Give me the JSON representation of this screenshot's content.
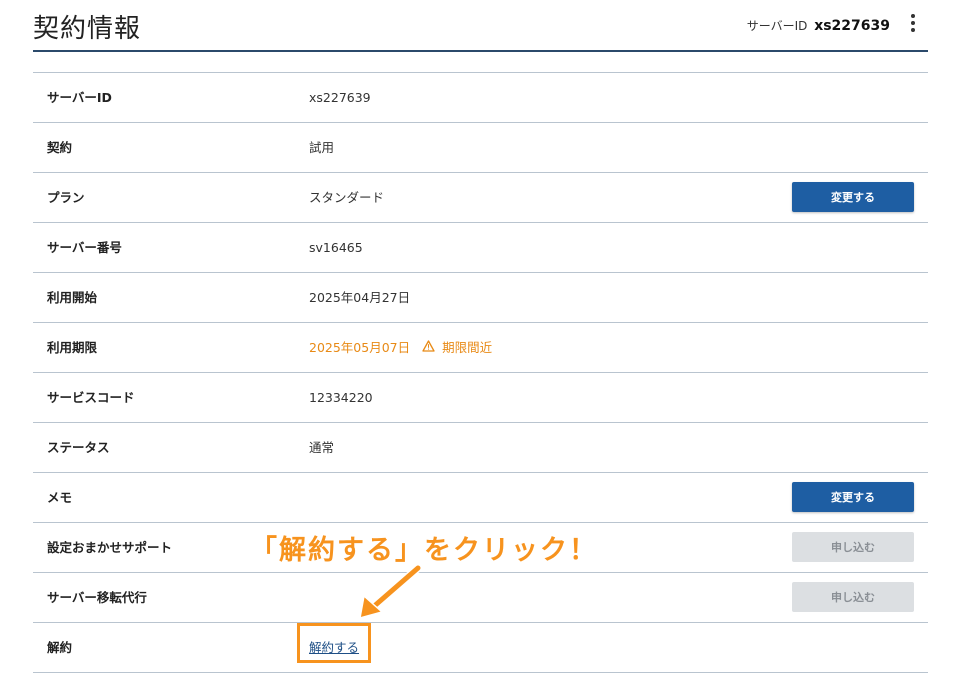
{
  "header": {
    "title": "契約情報",
    "server_id_label": "サーバーID",
    "server_id_value": "xs227639"
  },
  "rows": [
    {
      "label": "サーバーID",
      "value": "xs227639"
    },
    {
      "label": "契約",
      "value": "試用"
    },
    {
      "label": "プラン",
      "value": "スタンダード",
      "button": "変更する"
    },
    {
      "label": "サーバー番号",
      "value": "sv16465"
    },
    {
      "label": "利用開始",
      "value": "2025年04月27日"
    },
    {
      "label": "利用期限",
      "value": "2025年05月07日",
      "warning": "期限間近"
    },
    {
      "label": "サービスコード",
      "value": "12334220"
    },
    {
      "label": "ステータス",
      "value": "通常"
    },
    {
      "label": "メモ",
      "value": "",
      "button": "変更する"
    },
    {
      "label": "設定おまかせサポート",
      "value": "",
      "button": "申し込む"
    },
    {
      "label": "サーバー移転代行",
      "value": "",
      "button": "申し込む"
    },
    {
      "label": "解約",
      "link": "解約する"
    }
  ],
  "annotation": {
    "callout_text": "「解約する」をクリック！"
  },
  "colors": {
    "primary_button": "#1e5ea3",
    "disabled_button": "#dcdfe2",
    "warning": "#e88a16",
    "annotation": "#f7931e",
    "header_rule": "#2b4a6b"
  },
  "icons": {
    "menu": "kebab-menu-icon",
    "warning": "warning-triangle-icon"
  }
}
